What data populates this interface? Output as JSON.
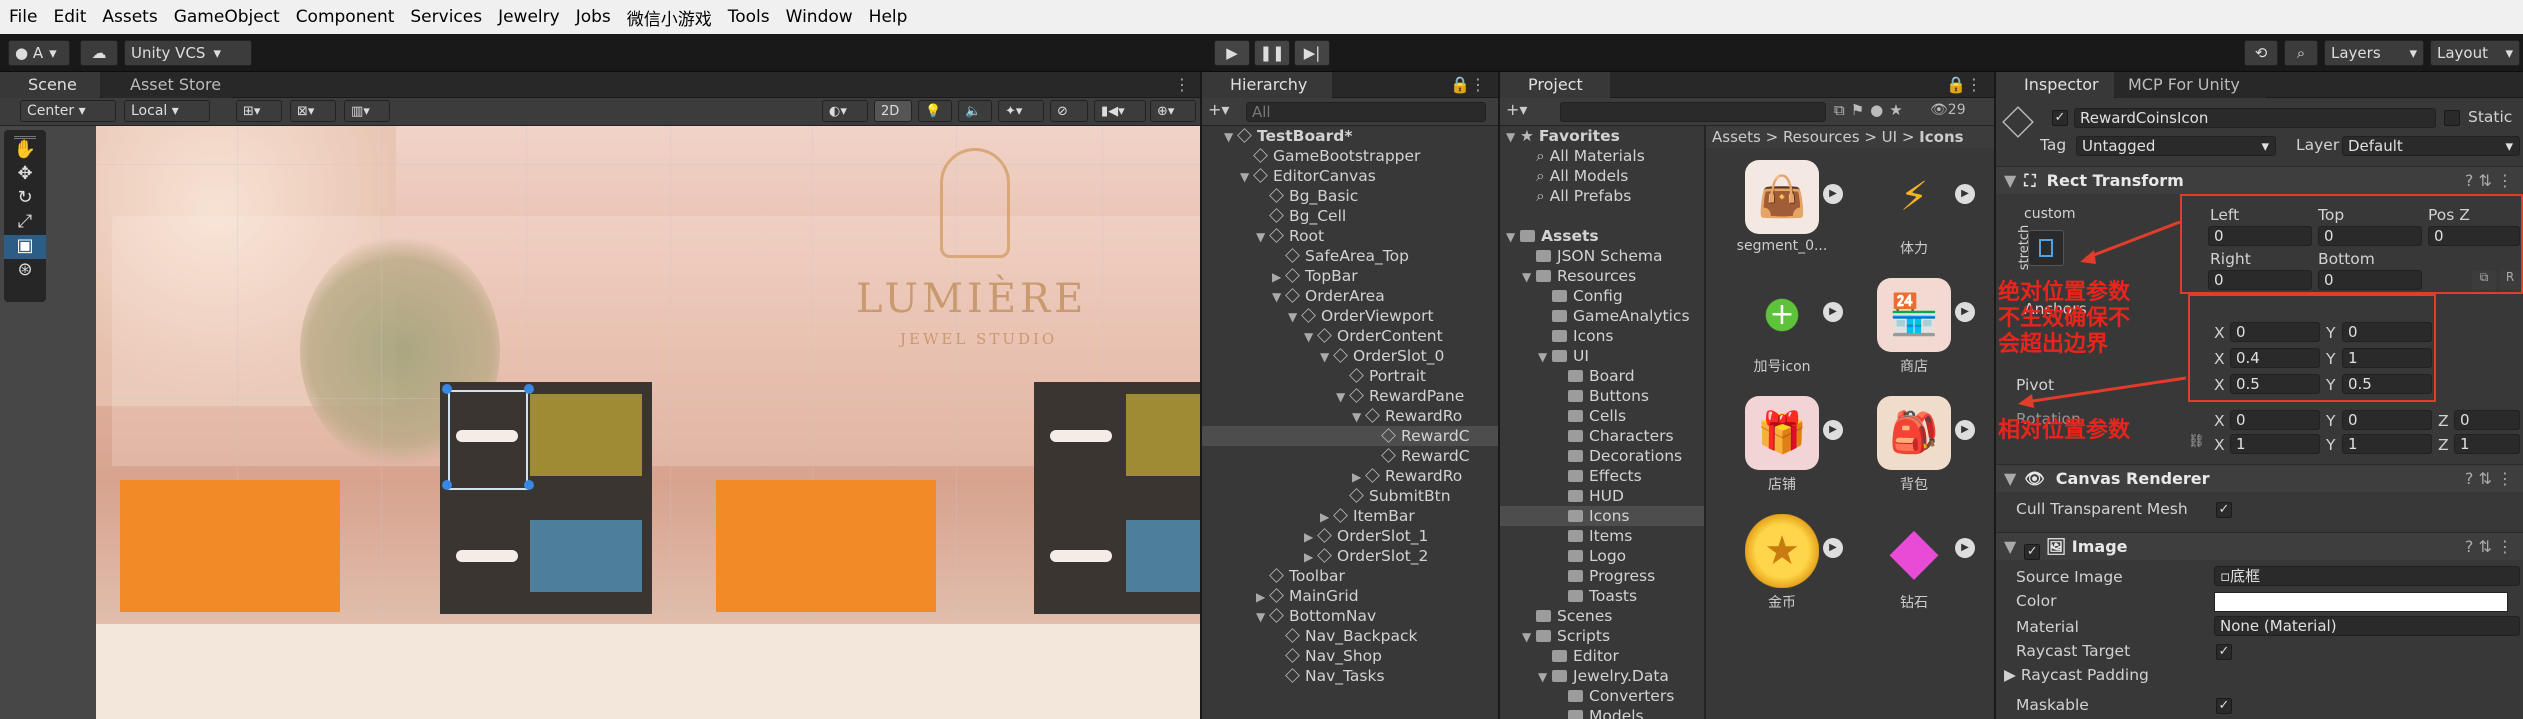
{
  "menu": [
    "File",
    "Edit",
    "Assets",
    "GameObject",
    "Component",
    "Services",
    "Jewelry",
    "Jobs",
    "微信小游戏",
    "Tools",
    "Window",
    "Help"
  ],
  "toolbar": {
    "account": "A",
    "vcs": "Unity VCS",
    "layers": "Layers",
    "layout": "Layout"
  },
  "scene": {
    "tab_scene": "Scene",
    "tab_asset_store": "Asset Store",
    "pivot": "Center",
    "space": "Local",
    "mode2d": "2D",
    "brand": "LUMIÈRE",
    "brand_sub": "JEWEL STUDIO"
  },
  "hierarchy": {
    "tab": "Hierarchy",
    "search_placeholder": "All",
    "items": [
      {
        "label": "TestBoard*",
        "indent": 0,
        "arrow": "▼",
        "root": true
      },
      {
        "label": "GameBootstrapper",
        "indent": 1,
        "arrow": ""
      },
      {
        "label": "EditorCanvas",
        "indent": 1,
        "arrow": "▼"
      },
      {
        "label": "Bg_Basic",
        "indent": 2,
        "arrow": ""
      },
      {
        "label": "Bg_Cell",
        "indent": 2,
        "arrow": ""
      },
      {
        "label": "Root",
        "indent": 2,
        "arrow": "▼"
      },
      {
        "label": "SafeArea_Top",
        "indent": 3,
        "arrow": ""
      },
      {
        "label": "TopBar",
        "indent": 3,
        "arrow": "▶"
      },
      {
        "label": "OrderArea",
        "indent": 3,
        "arrow": "▼"
      },
      {
        "label": "OrderViewport",
        "indent": 4,
        "arrow": "▼"
      },
      {
        "label": "OrderContent",
        "indent": 5,
        "arrow": "▼"
      },
      {
        "label": "OrderSlot_0",
        "indent": 6,
        "arrow": "▼"
      },
      {
        "label": "Portrait",
        "indent": 7,
        "arrow": ""
      },
      {
        "label": "RewardPane",
        "indent": 7,
        "arrow": "▼"
      },
      {
        "label": "RewardRo",
        "indent": 8,
        "arrow": "▼"
      },
      {
        "label": "RewardC",
        "indent": 9,
        "arrow": "",
        "selected": true
      },
      {
        "label": "RewardC",
        "indent": 9,
        "arrow": ""
      },
      {
        "label": "RewardRo",
        "indent": 8,
        "arrow": "▶"
      },
      {
        "label": "SubmitBtn",
        "indent": 7,
        "arrow": ""
      },
      {
        "label": "ItemBar",
        "indent": 6,
        "arrow": "▶"
      },
      {
        "label": "OrderSlot_1",
        "indent": 5,
        "arrow": "▶"
      },
      {
        "label": "OrderSlot_2",
        "indent": 5,
        "arrow": "▶"
      },
      {
        "label": "Toolbar",
        "indent": 2,
        "arrow": ""
      },
      {
        "label": "MainGrid",
        "indent": 2,
        "arrow": "▶"
      },
      {
        "label": "BottomNav",
        "indent": 2,
        "arrow": "▼"
      },
      {
        "label": "Nav_Backpack",
        "indent": 3,
        "arrow": ""
      },
      {
        "label": "Nav_Shop",
        "indent": 3,
        "arrow": ""
      },
      {
        "label": "Nav_Tasks",
        "indent": 3,
        "arrow": ""
      }
    ]
  },
  "project": {
    "tab": "Project",
    "count": "29",
    "breadcrumb": [
      "Assets",
      "Resources",
      "UI",
      "Icons"
    ],
    "tree": [
      {
        "label": "Favorites",
        "indent": 0,
        "arrow": "▼",
        "type": "star",
        "bold": true
      },
      {
        "label": "All Materials",
        "indent": 1,
        "arrow": "",
        "type": "search"
      },
      {
        "label": "All Models",
        "indent": 1,
        "arrow": "",
        "type": "search"
      },
      {
        "label": "All Prefabs",
        "indent": 1,
        "arrow": "",
        "type": "search"
      },
      {
        "label": "",
        "indent": 0,
        "arrow": "",
        "type": "blank"
      },
      {
        "label": "Assets",
        "indent": 0,
        "arrow": "▼",
        "type": "folder",
        "bold": true
      },
      {
        "label": "JSON Schema",
        "indent": 1,
        "arrow": "",
        "type": "folder"
      },
      {
        "label": "Resources",
        "indent": 1,
        "arrow": "▼",
        "type": "folder"
      },
      {
        "label": "Config",
        "indent": 2,
        "arrow": "",
        "type": "folder"
      },
      {
        "label": "GameAnalytics",
        "indent": 2,
        "arrow": "",
        "type": "folder"
      },
      {
        "label": "Icons",
        "indent": 2,
        "arrow": "",
        "type": "folder"
      },
      {
        "label": "UI",
        "indent": 2,
        "arrow": "▼",
        "type": "folder"
      },
      {
        "label": "Board",
        "indent": 3,
        "arrow": "",
        "type": "folder"
      },
      {
        "label": "Buttons",
        "indent": 3,
        "arrow": "",
        "type": "folder"
      },
      {
        "label": "Cells",
        "indent": 3,
        "arrow": "",
        "type": "folder"
      },
      {
        "label": "Characters",
        "indent": 3,
        "arrow": "",
        "type": "folder"
      },
      {
        "label": "Decorations",
        "indent": 3,
        "arrow": "",
        "type": "folder"
      },
      {
        "label": "Effects",
        "indent": 3,
        "arrow": "",
        "type": "folder"
      },
      {
        "label": "HUD",
        "indent": 3,
        "arrow": "",
        "type": "folder"
      },
      {
        "label": "Icons",
        "indent": 3,
        "arrow": "",
        "type": "folder",
        "selected": true
      },
      {
        "label": "Items",
        "indent": 3,
        "arrow": "",
        "type": "folder"
      },
      {
        "label": "Logo",
        "indent": 3,
        "arrow": "",
        "type": "folder"
      },
      {
        "label": "Progress",
        "indent": 3,
        "arrow": "",
        "type": "folder"
      },
      {
        "label": "Toasts",
        "indent": 3,
        "arrow": "",
        "type": "folder"
      },
      {
        "label": "Scenes",
        "indent": 1,
        "arrow": "",
        "type": "folder"
      },
      {
        "label": "Scripts",
        "indent": 1,
        "arrow": "▼",
        "type": "folder"
      },
      {
        "label": "Editor",
        "indent": 2,
        "arrow": "",
        "type": "folder"
      },
      {
        "label": "Jewelry.Data",
        "indent": 2,
        "arrow": "▼",
        "type": "folder"
      },
      {
        "label": "Converters",
        "indent": 3,
        "arrow": "",
        "type": "folder"
      },
      {
        "label": "Models",
        "indent": 3,
        "arrow": "",
        "type": "folder"
      }
    ],
    "assets": [
      {
        "label": "segment_0...",
        "icon": "bag-icon",
        "glyph": "👜",
        "bg": "#f3e8e2"
      },
      {
        "label": "体力",
        "icon": "lightning-icon",
        "glyph": "⚡",
        "bg": "#383838"
      },
      {
        "label": "加号icon",
        "icon": "plus-icon",
        "glyph": "+",
        "bg": "#383838"
      },
      {
        "label": "商店",
        "icon": "shop-icon",
        "glyph": "🏪",
        "bg": "#f2d9d2"
      },
      {
        "label": "店铺",
        "icon": "giftshop-icon",
        "glyph": "🎁",
        "bg": "#f2d4d6"
      },
      {
        "label": "背包",
        "icon": "backpack-icon",
        "glyph": "🎒",
        "bg": "#f0dccb"
      },
      {
        "label": "金币",
        "icon": "coin-icon",
        "glyph": "★",
        "bg": "#383838"
      },
      {
        "label": "钻石",
        "icon": "diamond-icon",
        "glyph": "◆",
        "bg": "#383838"
      }
    ]
  },
  "inspector": {
    "tab": "Inspector",
    "tab2": "MCP For Unity",
    "object_name": "RewardCoinsIcon",
    "static_label": "Static",
    "tag_label": "Tag",
    "tag_value": "Untagged",
    "layer_label": "Layer",
    "layer_value": "Default",
    "rect_transform": "Rect Transform",
    "anchor_preset": "custom",
    "stretch": "stretch",
    "left_label": "Left",
    "top_label": "Top",
    "posz_label": "Pos Z",
    "left": "0",
    "top": "0",
    "posz": "0",
    "right_label": "Right",
    "bottom_label": "Bottom",
    "right": "0",
    "bottom": "0",
    "anchors_label": "Anchors",
    "min_x": "0",
    "min_y": "0",
    "max_x": "0.4",
    "max_y": "1",
    "pivot_label": "Pivot",
    "pivot_x": "0.5",
    "pivot_y": "0.5",
    "rotation_label": "Rotation",
    "rot_x": "0",
    "rot_y": "0",
    "rot_z": "0",
    "scale_x": "1",
    "scale_y": "1",
    "scale_z": "1",
    "canvas_renderer": "Canvas Renderer",
    "cull": "Cull Transparent Mesh",
    "image": "Image",
    "source_image_label": "Source Image",
    "source_image": "底框",
    "color_label": "Color",
    "material_label": "Material",
    "material": "None (Material)",
    "raycast_target": "Raycast Target",
    "raycast_padding": "Raycast Padding",
    "maskable": "Maskable",
    "annot_abs": [
      "绝对位置参数",
      "不生效确保不",
      "会超出边界"
    ],
    "annot_rel": "相对位置参数"
  },
  "colors": {
    "accent_red": "#e23c2a",
    "selection": "#2c5d87",
    "orange": "#f28a25"
  }
}
